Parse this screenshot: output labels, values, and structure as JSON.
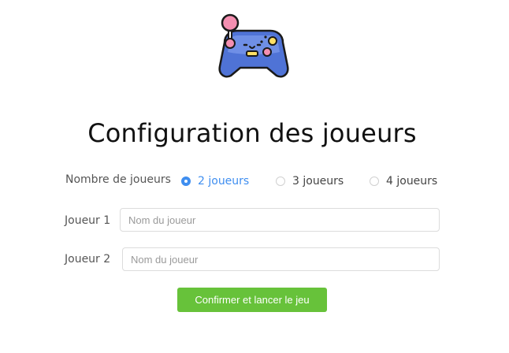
{
  "header": {
    "logo_icon": "gamepad-icon",
    "title": "Configuration des joueurs"
  },
  "players_count": {
    "label": "Nombre de joueurs",
    "options": [
      {
        "label": "2 joueurs",
        "selected": true
      },
      {
        "label": "3 joueurs",
        "selected": false
      },
      {
        "label": "4 joueurs",
        "selected": false
      }
    ]
  },
  "players": [
    {
      "label": "Joueur 1",
      "placeholder": "Nom du joueur",
      "value": ""
    },
    {
      "label": "Joueur 2",
      "placeholder": "Nom du joueur",
      "value": ""
    }
  ],
  "submit_label": "Confirmer et lancer le jeu",
  "colors": {
    "accent": "#3f8ef0",
    "submit": "#67c23a",
    "gamepad_body": "#4f73d6",
    "joystick": "#f48fb1"
  }
}
